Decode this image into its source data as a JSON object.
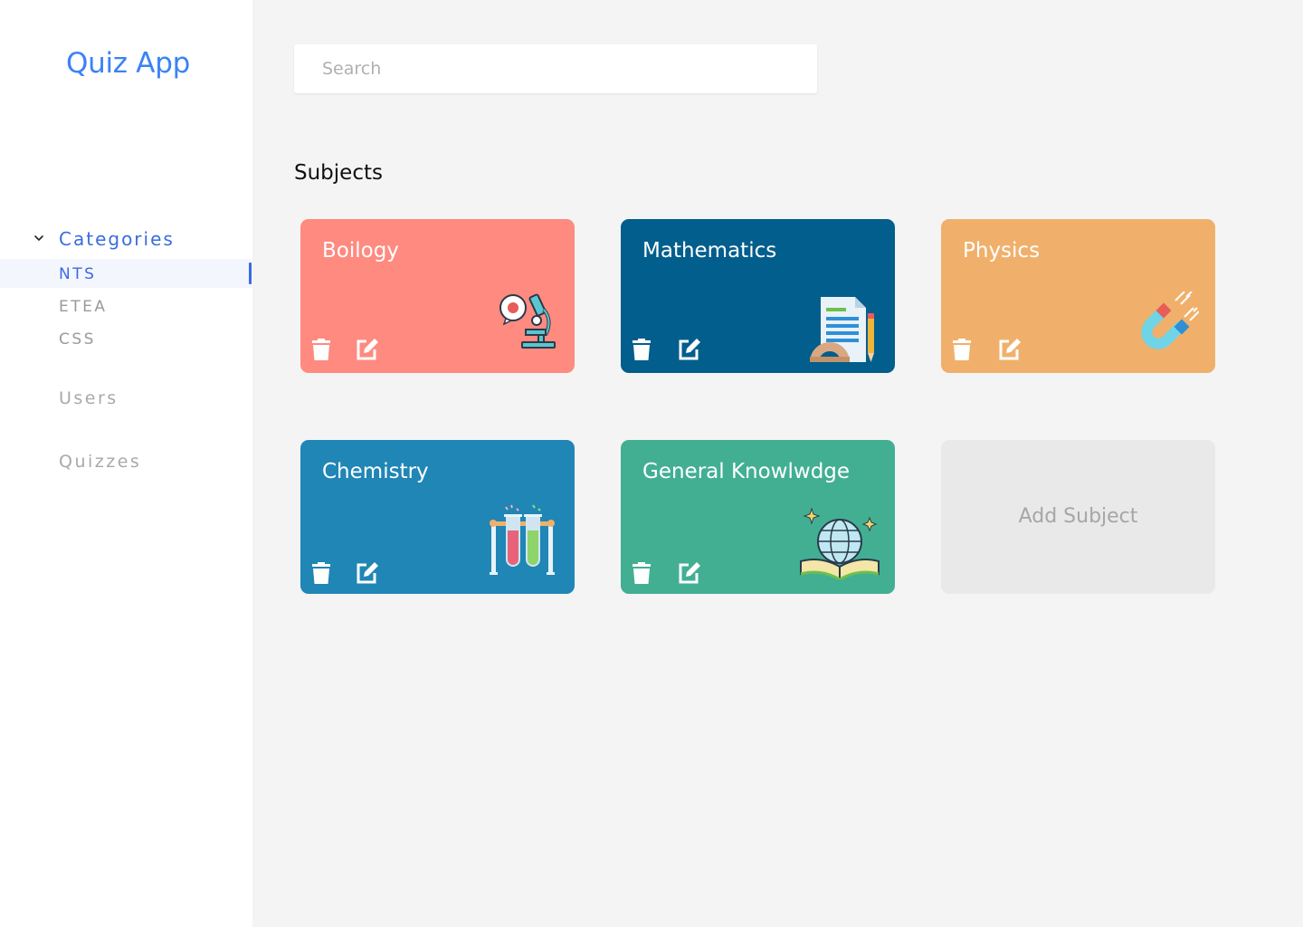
{
  "app": {
    "title": "Quiz App"
  },
  "sidebar": {
    "categories_label": "Categories",
    "subitems": [
      {
        "label": "NTS",
        "active": true
      },
      {
        "label": "ETEA",
        "active": false
      },
      {
        "label": "CSS",
        "active": false
      }
    ],
    "nav": [
      {
        "label": "Users"
      },
      {
        "label": "Quizzes"
      }
    ]
  },
  "search": {
    "placeholder": "Search",
    "value": ""
  },
  "main": {
    "section_title": "Subjects",
    "subjects": [
      {
        "name": "Boilogy",
        "color": "#ff8a80",
        "icon": "microscope-icon"
      },
      {
        "name": "Mathematics",
        "color": "#025e8c",
        "icon": "math-document-icon"
      },
      {
        "name": "Physics",
        "color": "#f0b06b",
        "icon": "magnet-icon"
      },
      {
        "name": "Chemistry",
        "color": "#1f86b6",
        "icon": "test-tubes-icon"
      },
      {
        "name": "General Knowlwdge",
        "color": "#42af93",
        "icon": "globe-book-icon"
      }
    ],
    "add_label": "Add Subject"
  },
  "colors": {
    "accent": "#3a6be0",
    "logo": "#3b82f6"
  }
}
